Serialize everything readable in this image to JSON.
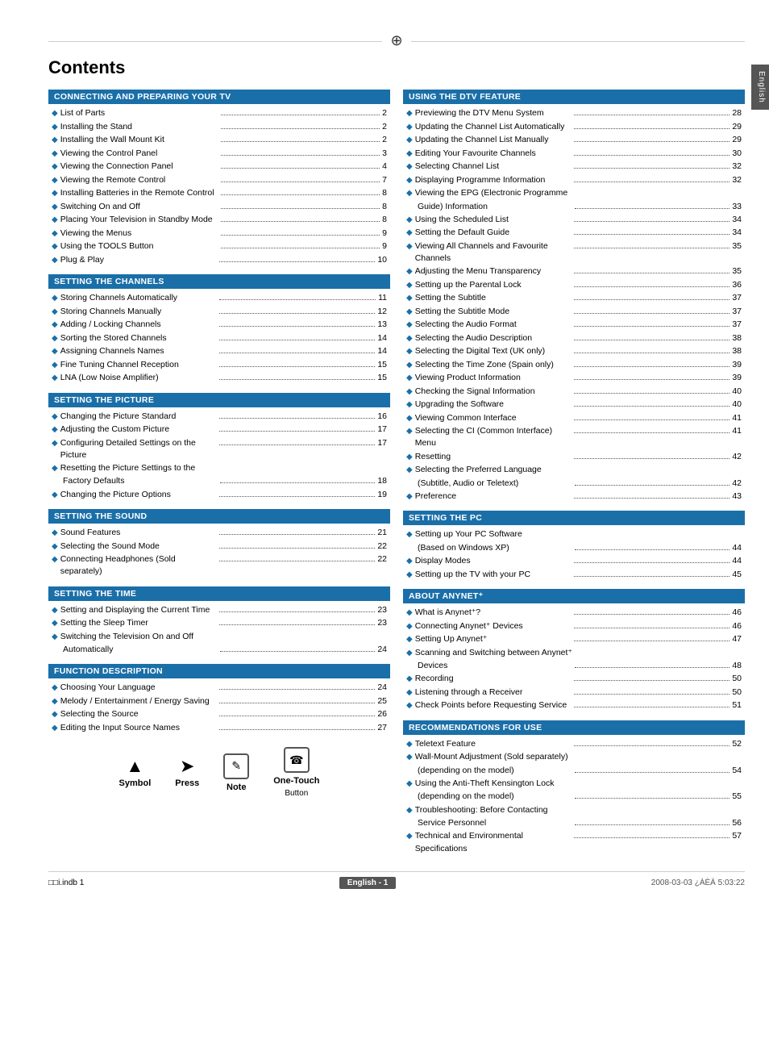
{
  "page": {
    "title": "Contents",
    "side_tab": "English",
    "crosshair_symbol": "⊕",
    "footer": {
      "left": "□□i.indb   1",
      "center": "English - 1",
      "right": "2008-03-03   ¿ÀÈÄ 5:03:22"
    }
  },
  "symbols": [
    {
      "id": "symbol",
      "icon": "▲",
      "label": "Symbol",
      "sublabel": ""
    },
    {
      "id": "press",
      "icon": "➤",
      "label": "Press",
      "sublabel": ""
    },
    {
      "id": "note",
      "icon": "Note",
      "label": "Note",
      "sublabel": ""
    },
    {
      "id": "one-touch",
      "icon": "☎",
      "label": "One-Touch",
      "sublabel": "Button"
    }
  ],
  "sections_left": [
    {
      "id": "connecting",
      "header": "CONNECTING AND PREPARING YOUR TV",
      "items": [
        {
          "text": "List of Parts",
          "dots": true,
          "page": "2"
        },
        {
          "text": "Installing the Stand",
          "dots": true,
          "page": "2"
        },
        {
          "text": "Installing the Wall Mount Kit",
          "dots": true,
          "page": "2"
        },
        {
          "text": "Viewing the Control Panel",
          "dots": true,
          "page": "3"
        },
        {
          "text": "Viewing the Connection Panel",
          "dots": true,
          "page": "4"
        },
        {
          "text": "Viewing the Remote Control",
          "dots": true,
          "page": "7"
        },
        {
          "text": "Installing Batteries in the Remote Control",
          "dots": true,
          "page": "8"
        },
        {
          "text": "Switching On and Off",
          "dots": true,
          "page": "8"
        },
        {
          "text": "Placing Your Television in Standby Mode",
          "dots": true,
          "page": "8"
        },
        {
          "text": "Viewing the Menus",
          "dots": true,
          "page": "9"
        },
        {
          "text": "Using the TOOLS Button",
          "dots": true,
          "page": "9"
        },
        {
          "text": "Plug & Play",
          "dots": true,
          "page": "10"
        }
      ]
    },
    {
      "id": "channels",
      "header": "SETTING THE CHANNELS",
      "items": [
        {
          "text": "Storing Channels Automatically",
          "dots": true,
          "page": "11"
        },
        {
          "text": "Storing Channels Manually",
          "dots": true,
          "page": "12"
        },
        {
          "text": "Adding / Locking Channels",
          "dots": true,
          "page": "13"
        },
        {
          "text": "Sorting the Stored Channels",
          "dots": true,
          "page": "14"
        },
        {
          "text": "Assigning Channels Names",
          "dots": true,
          "page": "14"
        },
        {
          "text": "Fine Tuning Channel Reception",
          "dots": true,
          "page": "15"
        },
        {
          "text": "LNA (Low Noise Amplifier)",
          "dots": true,
          "page": "15"
        }
      ]
    },
    {
      "id": "picture",
      "header": "SETTING THE PICTURE",
      "items": [
        {
          "text": "Changing the Picture Standard",
          "dots": true,
          "page": "16"
        },
        {
          "text": "Adjusting the Custom Picture",
          "dots": true,
          "page": "17"
        },
        {
          "text": "Configuring Detailed Settings on the Picture",
          "dots": true,
          "page": "17"
        },
        {
          "text": "Resetting the Picture Settings to the",
          "dots": false,
          "page": ""
        },
        {
          "text": "Factory Defaults",
          "dots": true,
          "page": "18",
          "indent": true
        },
        {
          "text": "Changing the Picture Options",
          "dots": true,
          "page": "19"
        }
      ]
    },
    {
      "id": "sound",
      "header": "SETTING THE SOUND",
      "items": [
        {
          "text": "Sound Features",
          "dots": true,
          "page": "21"
        },
        {
          "text": "Selecting the Sound Mode",
          "dots": true,
          "page": "22"
        },
        {
          "text": "Connecting Headphones (Sold separately)",
          "dots": true,
          "page": "22"
        }
      ]
    },
    {
      "id": "time",
      "header": "SETTING THE TIME",
      "items": [
        {
          "text": "Setting and Displaying the Current Time",
          "dots": true,
          "page": "23"
        },
        {
          "text": "Setting the Sleep Timer",
          "dots": true,
          "page": "23"
        },
        {
          "text": "Switching the Television On and Off",
          "dots": false,
          "page": ""
        },
        {
          "text": "Automatically",
          "dots": true,
          "page": "24",
          "indent": true
        }
      ]
    },
    {
      "id": "function",
      "header": "FUNCTION DESCRIPTION",
      "items": [
        {
          "text": "Choosing Your Language",
          "dots": true,
          "page": "24"
        },
        {
          "text": "Melody / Entertainment / Energy Saving",
          "dots": true,
          "page": "25"
        },
        {
          "text": "Selecting the Source",
          "dots": true,
          "page": "26"
        },
        {
          "text": "Editing the Input Source Names",
          "dots": true,
          "page": "27"
        }
      ]
    }
  ],
  "sections_right": [
    {
      "id": "dtv",
      "header": "USING THE DTV FEATURE",
      "items": [
        {
          "text": "Previewing the DTV Menu System",
          "dots": true,
          "page": "28"
        },
        {
          "text": "Updating the Channel List Automatically",
          "dots": true,
          "page": "29"
        },
        {
          "text": "Updating the Channel List Manually",
          "dots": true,
          "page": "29"
        },
        {
          "text": "Editing Your Favourite Channels",
          "dots": true,
          "page": "30"
        },
        {
          "text": "Selecting Channel List",
          "dots": true,
          "page": "32"
        },
        {
          "text": "Displaying Programme Information",
          "dots": true,
          "page": "32"
        },
        {
          "text": "Viewing the EPG (Electronic Programme",
          "dots": false,
          "page": ""
        },
        {
          "text": "Guide) Information",
          "dots": true,
          "page": "33",
          "indent": true
        },
        {
          "text": "Using the Scheduled List",
          "dots": true,
          "page": "34"
        },
        {
          "text": "Setting the Default Guide",
          "dots": true,
          "page": "34"
        },
        {
          "text": "Viewing All Channels and Favourite Channels",
          "dots": true,
          "page": "35"
        },
        {
          "text": "Adjusting the Menu Transparency",
          "dots": true,
          "page": "35"
        },
        {
          "text": "Setting up the Parental Lock",
          "dots": true,
          "page": "36"
        },
        {
          "text": "Setting the Subtitle",
          "dots": true,
          "page": "37"
        },
        {
          "text": "Setting the Subtitle Mode",
          "dots": true,
          "page": "37"
        },
        {
          "text": "Selecting the Audio Format",
          "dots": true,
          "page": "37"
        },
        {
          "text": "Selecting the Audio Description",
          "dots": true,
          "page": "38"
        },
        {
          "text": "Selecting the Digital Text (UK only)",
          "dots": true,
          "page": "38"
        },
        {
          "text": "Selecting the Time Zone (Spain only)",
          "dots": true,
          "page": "39"
        },
        {
          "text": "Viewing Product Information",
          "dots": true,
          "page": "39"
        },
        {
          "text": "Checking the Signal Information",
          "dots": true,
          "page": "40"
        },
        {
          "text": "Upgrading the Software",
          "dots": true,
          "page": "40"
        },
        {
          "text": "Viewing Common Interface",
          "dots": true,
          "page": "41"
        },
        {
          "text": "Selecting the CI (Common Interface) Menu",
          "dots": true,
          "page": "41"
        },
        {
          "text": "Resetting",
          "dots": true,
          "page": "42"
        },
        {
          "text": "Selecting the Preferred Language",
          "dots": false,
          "page": ""
        },
        {
          "text": "(Subtitle, Audio or Teletext)",
          "dots": true,
          "page": "42",
          "indent": true
        },
        {
          "text": "Preference",
          "dots": true,
          "page": "43"
        }
      ]
    },
    {
      "id": "pc",
      "header": "SETTING THE PC",
      "items": [
        {
          "text": "Setting up Your PC Software",
          "dots": false,
          "page": ""
        },
        {
          "text": "(Based on Windows XP)",
          "dots": true,
          "page": "44",
          "indent": true
        },
        {
          "text": "Display Modes",
          "dots": true,
          "page": "44"
        },
        {
          "text": "Setting up the TV with your PC",
          "dots": true,
          "page": "45"
        }
      ]
    },
    {
      "id": "anynet",
      "header": "ABOUT ANYNET⁺",
      "items": [
        {
          "text": "What is Anynet⁺?",
          "dots": true,
          "page": "46"
        },
        {
          "text": "Connecting Anynet⁺ Devices",
          "dots": true,
          "page": "46"
        },
        {
          "text": "Setting Up Anynet⁺",
          "dots": true,
          "page": "47"
        },
        {
          "text": "Scanning and Switching between Anynet⁺",
          "dots": false,
          "page": ""
        },
        {
          "text": "Devices",
          "dots": true,
          "page": "48",
          "indent": true
        },
        {
          "text": "Recording",
          "dots": true,
          "page": "50"
        },
        {
          "text": "Listening through a Receiver",
          "dots": true,
          "page": "50"
        },
        {
          "text": "Check Points before Requesting Service",
          "dots": true,
          "page": "51"
        }
      ]
    },
    {
      "id": "recommendations",
      "header": "RECOMMENDATIONS FOR USE",
      "items": [
        {
          "text": "Teletext Feature",
          "dots": true,
          "page": "52"
        },
        {
          "text": "Wall-Mount Adjustment (Sold separately)",
          "dots": false,
          "page": ""
        },
        {
          "text": "(depending on the model)",
          "dots": true,
          "page": "54",
          "indent": true
        },
        {
          "text": "Using the Anti-Theft Kensington Lock",
          "dots": false,
          "page": ""
        },
        {
          "text": "(depending on the model)",
          "dots": true,
          "page": "55",
          "indent": true
        },
        {
          "text": "Troubleshooting: Before Contacting",
          "dots": false,
          "page": ""
        },
        {
          "text": "Service Personnel",
          "dots": true,
          "page": "56",
          "indent": true
        },
        {
          "text": "Technical and Environmental Specifications",
          "dots": true,
          "page": "57"
        }
      ]
    }
  ]
}
